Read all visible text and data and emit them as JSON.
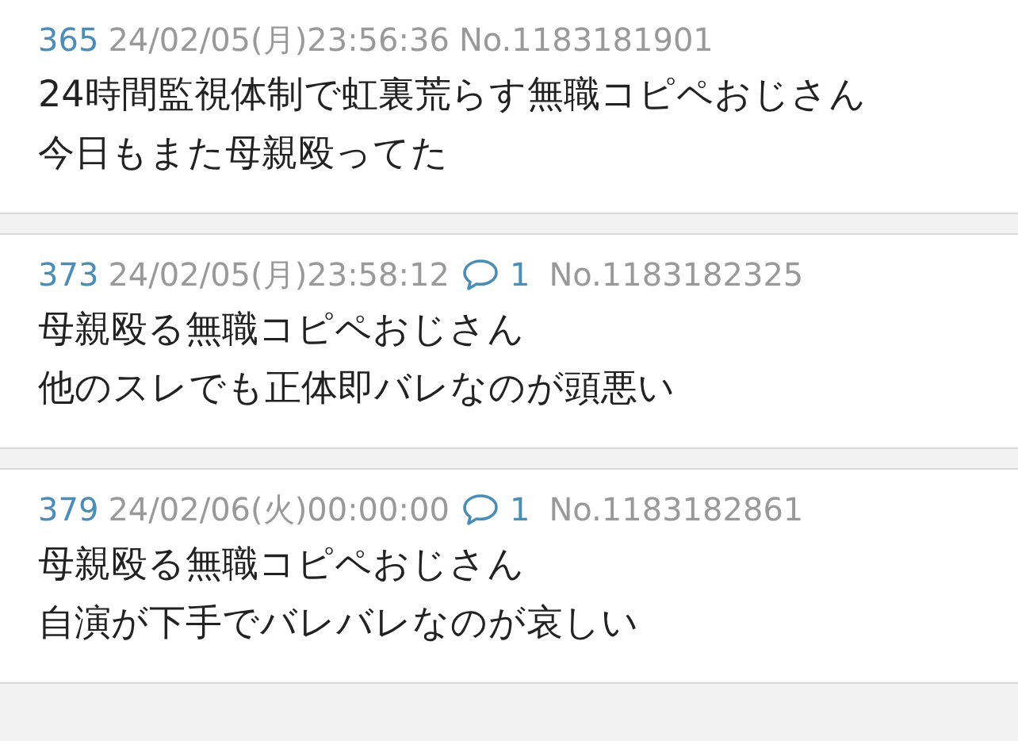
{
  "posts": [
    {
      "number": "365",
      "date": "24/02/05(月)23:56:36",
      "id": "No.1183181901",
      "lines": [
        "24時間監視体制で虹裏荒らす無職コピペおじさん",
        "今日もまた母親殴ってた"
      ]
    },
    {
      "number": "373",
      "date": "24/02/05(月)23:58:12",
      "replies": "1",
      "id": "No.1183182325",
      "lines": [
        "母親殴る無職コピペおじさん",
        "他のスレでも正体即バレなのが頭悪い"
      ]
    },
    {
      "number": "379",
      "date": "24/02/06(火)00:00:00",
      "replies": "1",
      "id": "No.1183182861",
      "lines": [
        "母親殴る無職コピペおじさん",
        "自演が下手でバレバレなのが哀しい"
      ]
    }
  ]
}
